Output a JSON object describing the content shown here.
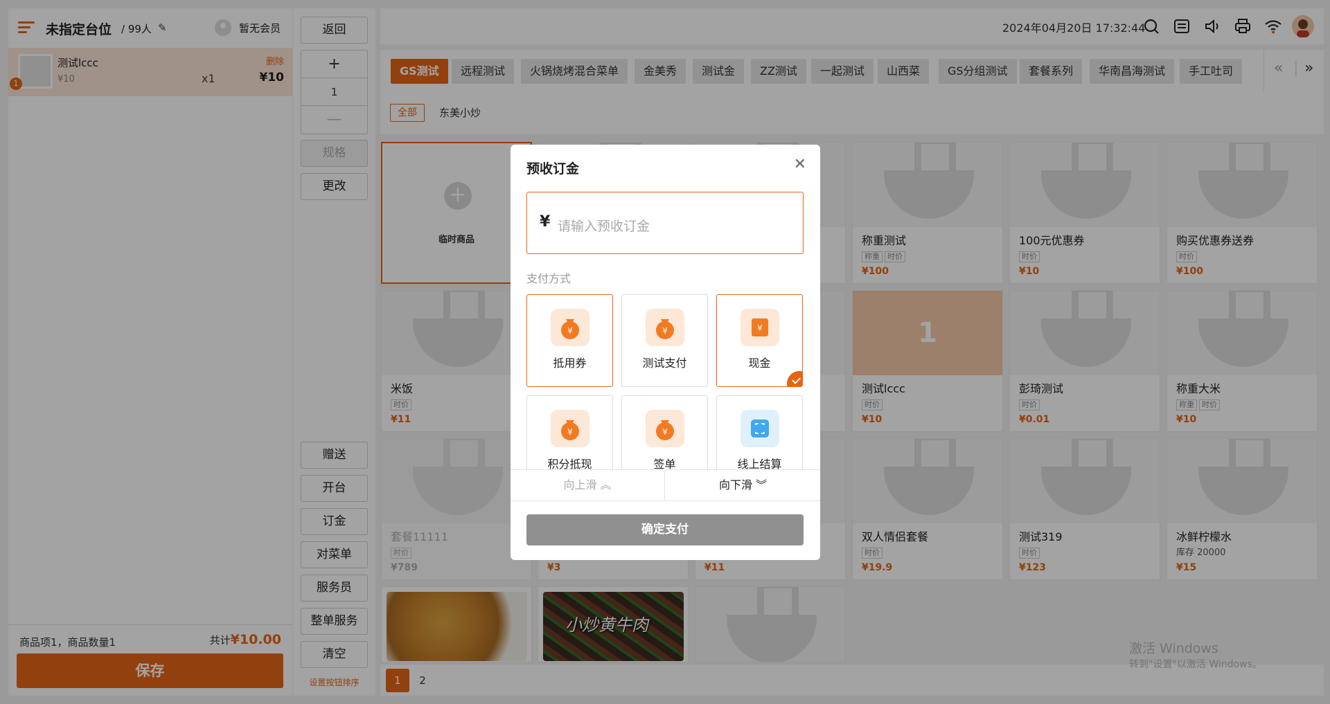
{
  "header": {
    "table_name": "未指定台位",
    "people": "/ 99人",
    "member": "暂无会员"
  },
  "order": {
    "items": [
      {
        "name": "测试lccc",
        "price": "¥10",
        "qty": "x1",
        "total": "¥10",
        "badge": "1",
        "delete": "删除"
      }
    ],
    "summary": "商品项1，商品数量1",
    "total_label": "共计",
    "total_value": "¥10.00",
    "save": "保存"
  },
  "actions": {
    "back": "返回",
    "plus": "+",
    "qty": "1",
    "minus": "—",
    "spec": "规格",
    "change": "更改",
    "gift": "赠送",
    "open": "开台",
    "deposit": "订金",
    "menu_check": "对菜单",
    "waiter": "服务员",
    "whole": "整单服务",
    "clear": "清空",
    "sort_link": "设置按钮排序"
  },
  "topbar": {
    "datetime": "2024年04月20日 17:32:44"
  },
  "categories": [
    {
      "label": "GS测试",
      "active": true
    },
    {
      "label": "远程测试"
    },
    {
      "label": "火锅烧烤混合菜单"
    },
    {
      "label": "金美秀"
    },
    {
      "label": "测试金"
    },
    {
      "label": "ZZ测试"
    },
    {
      "label": "一起测试"
    },
    {
      "label": "山西菜"
    },
    {
      "label": "GS分组测试"
    },
    {
      "label": "套餐系列"
    },
    {
      "label": "华南昌海测试"
    },
    {
      "label": "手工吐司"
    }
  ],
  "subcategories": {
    "all": "全部",
    "second": "东美小炒"
  },
  "products": {
    "temp": "临时商品",
    "p1": {
      "name": "称重测试",
      "tags": [
        "称重",
        "时价"
      ],
      "price": "¥100"
    },
    "p2": {
      "name": "100元优惠券",
      "tags": [
        "时价"
      ],
      "price": "¥10"
    },
    "p3": {
      "name": "购买优惠券送券",
      "tags": [
        "时价"
      ],
      "price": "¥100"
    },
    "p4": {
      "name": "米饭",
      "tags": [
        "时价"
      ],
      "price": "¥11"
    },
    "p5": {
      "name": "测试lccc",
      "tags": [
        "时价"
      ],
      "price": "¥10",
      "count": "1"
    },
    "p6": {
      "name": "彭琦测试",
      "tags": [
        "时价"
      ],
      "price": "¥0.01"
    },
    "p7": {
      "name": "称重大米",
      "tags": [
        "称重",
        "时价"
      ],
      "price": "¥10"
    },
    "p8": {
      "name": "套餐11111",
      "tags": [
        "时价"
      ],
      "price": "¥789"
    },
    "p9": {
      "price": "¥3"
    },
    "p10": {
      "price": "¥11"
    },
    "p11": {
      "name": "双人情侣套餐",
      "tags": [
        "时价"
      ],
      "price": "¥19.9"
    },
    "p12": {
      "name": "测试319",
      "tags": [
        "时价"
      ],
      "price": "¥123"
    },
    "p13": {
      "name": "冰鲜柠檬水",
      "stock": "库存  20000",
      "price": "¥15"
    },
    "food_text": "小炒黄牛肉"
  },
  "pagination": {
    "pages": [
      "1",
      "2"
    ],
    "current": "1"
  },
  "watermark": {
    "line1": "激活 Windows",
    "line2": "转到\"设置\"以激活 Windows。"
  },
  "modal": {
    "title": "预收订金",
    "currency": "¥",
    "placeholder": "请输入预收订金",
    "pay_method_label": "支付方式",
    "methods": [
      {
        "label": "抵用券",
        "selected": false
      },
      {
        "label": "测试支付",
        "selected": false
      },
      {
        "label": "现金",
        "selected": true
      },
      {
        "label": "积分抵现",
        "selected": false
      },
      {
        "label": "签单",
        "selected": false
      },
      {
        "label": "线上结算",
        "selected": false
      }
    ],
    "scroll_up": "向上滑",
    "scroll_down": "向下滑",
    "confirm": "确定支付"
  },
  "colors": {
    "accent": "#e56416",
    "selected_bg": "#fbe5d6",
    "confirm_disabled": "#909090"
  }
}
